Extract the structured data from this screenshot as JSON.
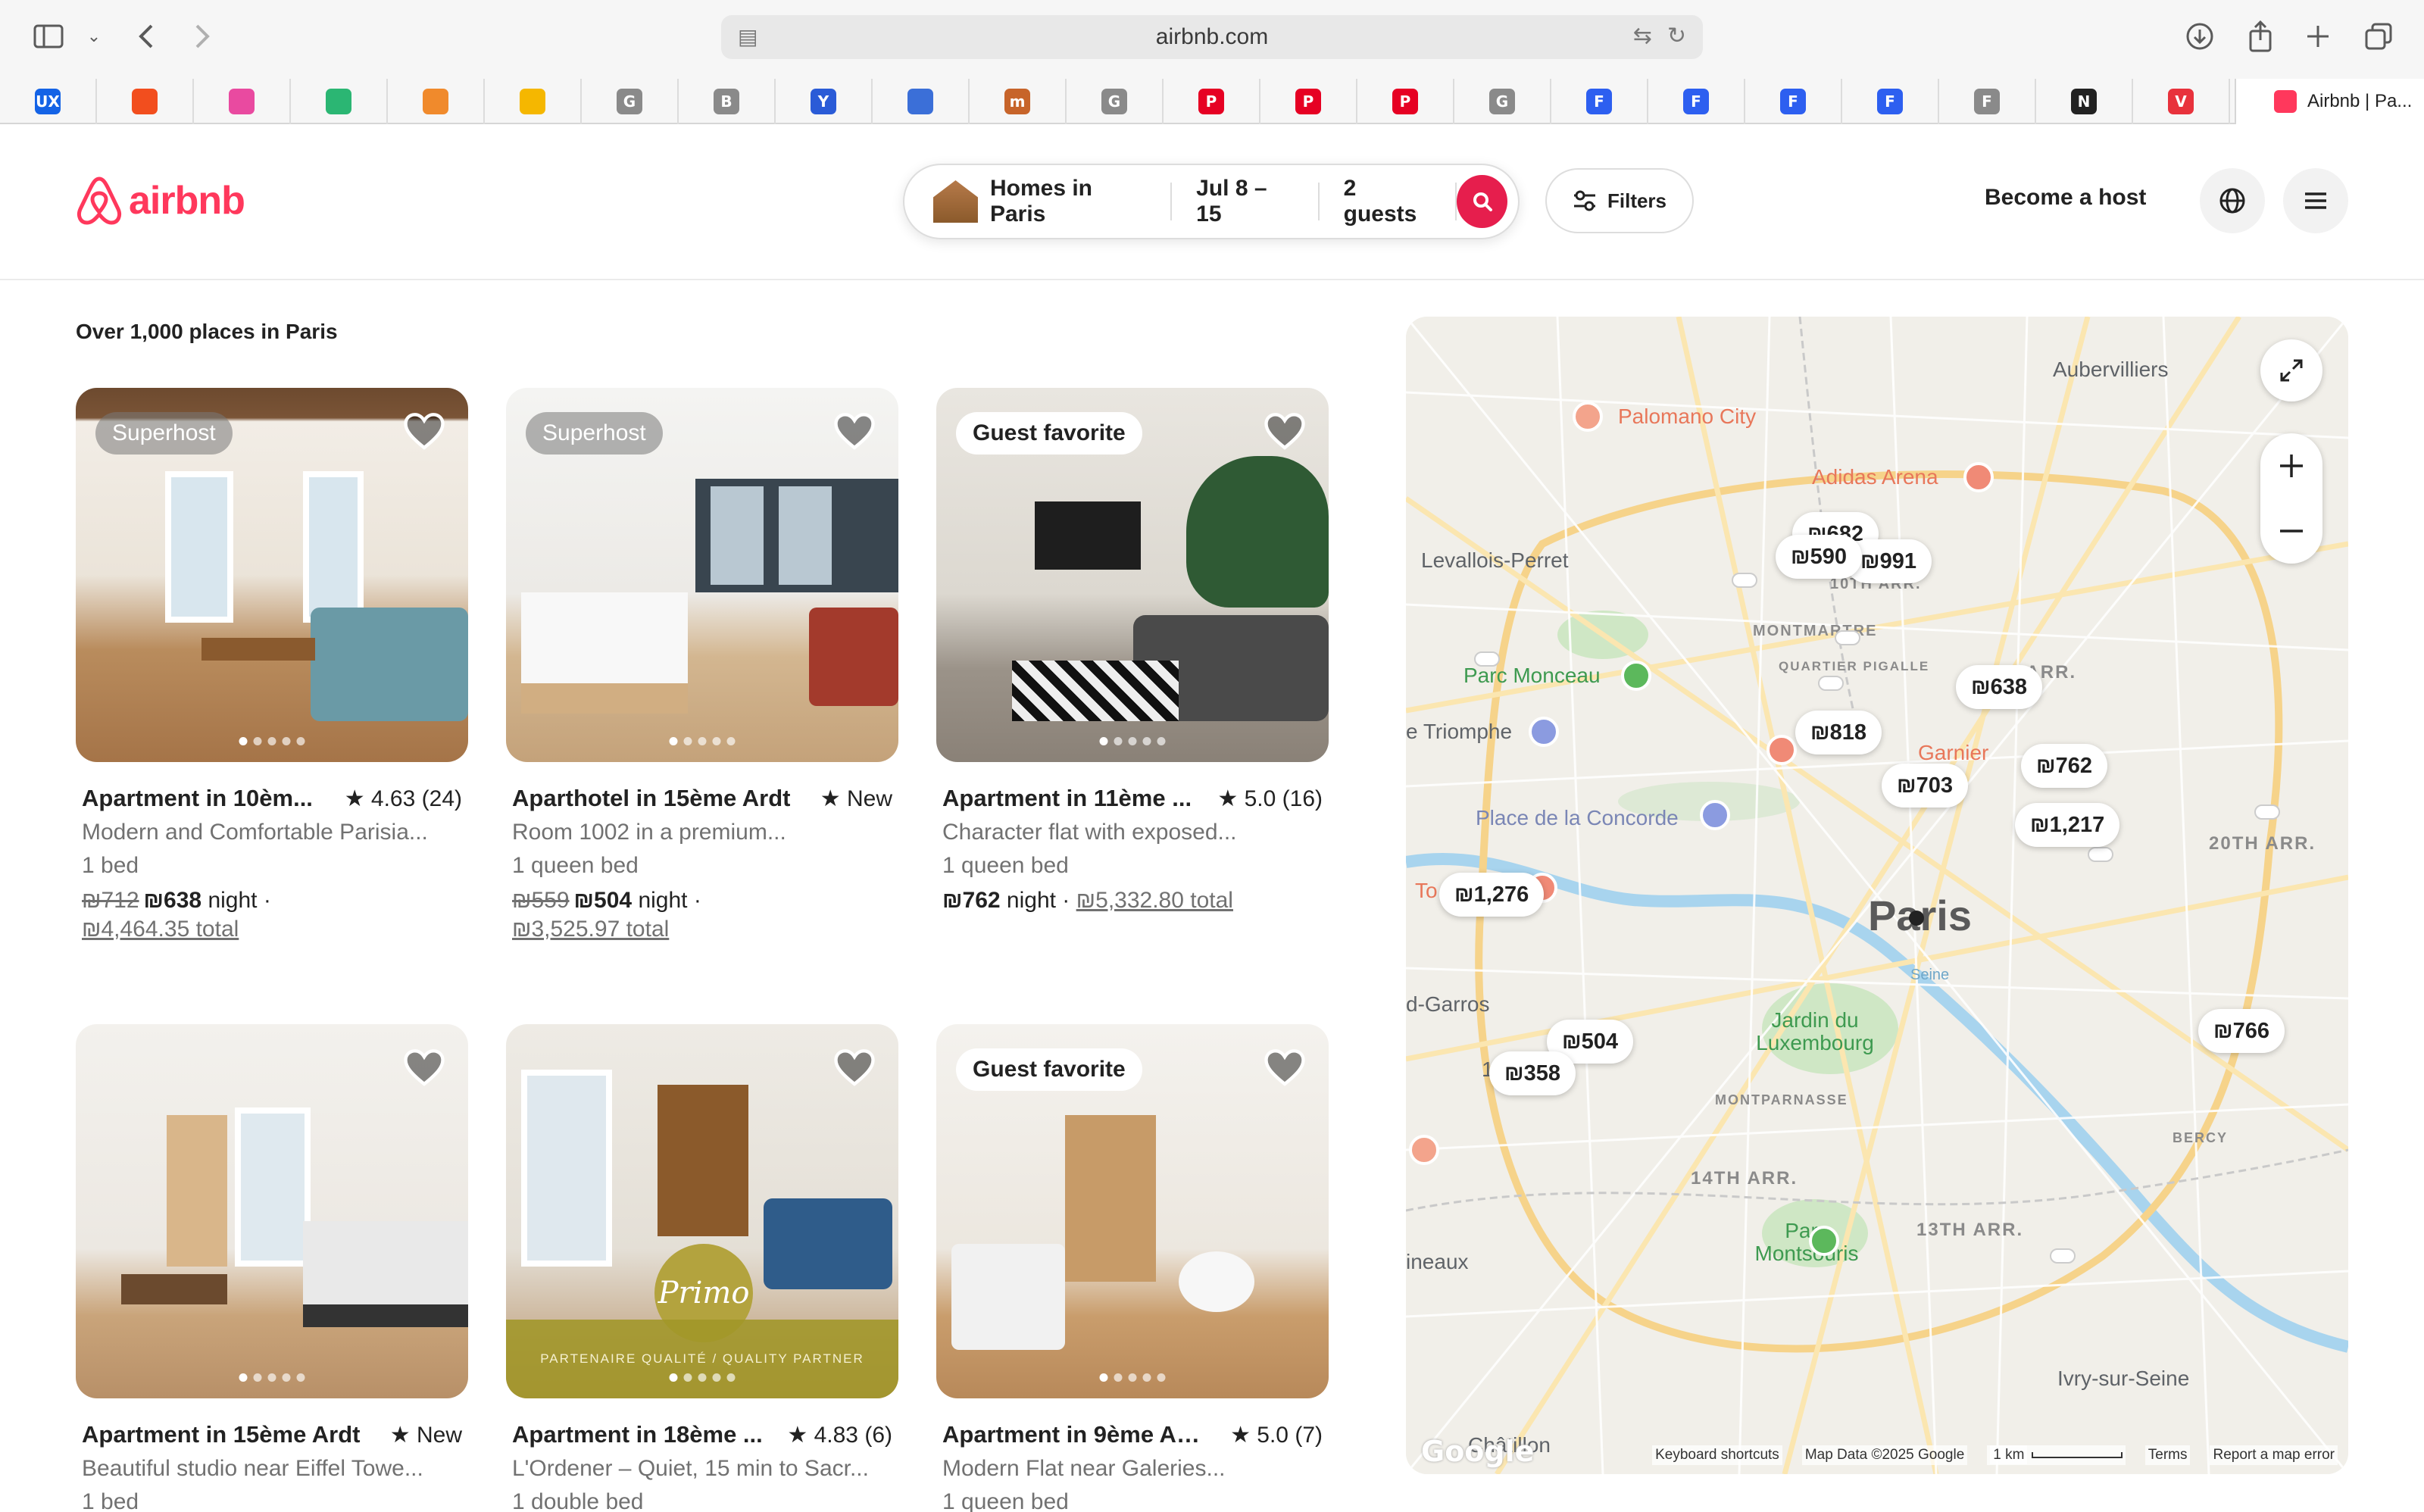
{
  "browser": {
    "address": "airbnb.com",
    "active_tab_title": "Airbnb | Pa...",
    "bookmarks": [
      {
        "icon": "ux-icon",
        "label": "UX",
        "color": "#1463e6"
      },
      {
        "icon": "figma-icon",
        "label": "",
        "color": "#f24e1e"
      },
      {
        "icon": "pink-app-icon",
        "label": "",
        "color": "#e94aa0"
      },
      {
        "icon": "green-k-icon",
        "label": "",
        "color": "#2bb673"
      },
      {
        "icon": "orange-circle-icon",
        "label": "",
        "color": "#f08a2c"
      },
      {
        "icon": "smiley-icon",
        "label": "",
        "color": "#f5b700"
      },
      {
        "icon": "grey-g-icon",
        "label": "G",
        "color": "#8a8a8a"
      },
      {
        "icon": "grey-b-icon",
        "label": "B",
        "color": "#8a8a8a"
      },
      {
        "icon": "y-icon",
        "label": "Y",
        "color": "#2a5bd7"
      },
      {
        "icon": "loader-icon",
        "label": "",
        "color": "#3b6fd8"
      },
      {
        "icon": "m-icon",
        "label": "m",
        "color": "#c7642a"
      },
      {
        "icon": "grey-g-icon",
        "label": "G",
        "color": "#8a8a8a"
      },
      {
        "icon": "pinterest-icon",
        "label": "P",
        "color": "#e60023"
      },
      {
        "icon": "pinterest-icon",
        "label": "P",
        "color": "#e60023"
      },
      {
        "icon": "pinterest-icon",
        "label": "P",
        "color": "#e60023"
      },
      {
        "icon": "grey-g-icon",
        "label": "G",
        "color": "#8a8a8a"
      },
      {
        "icon": "blue-f-icon",
        "label": "F",
        "color": "#2d5ff0"
      },
      {
        "icon": "blue-f-icon",
        "label": "F",
        "color": "#2d5ff0"
      },
      {
        "icon": "blue-f-icon",
        "label": "F",
        "color": "#2d5ff0"
      },
      {
        "icon": "blue-f-icon",
        "label": "F",
        "color": "#2d5ff0"
      },
      {
        "icon": "grey-f-icon",
        "label": "F",
        "color": "#8a8a8a"
      },
      {
        "icon": "notion-icon",
        "label": "N",
        "color": "#222222"
      },
      {
        "icon": "red-v-icon",
        "label": "V",
        "color": "#e8323c"
      }
    ]
  },
  "header": {
    "logo_text": "airbnb",
    "search": {
      "location": "Homes in Paris",
      "dates": "Jul 8 – 15",
      "guests": "2 guests"
    },
    "filters_label": "Filters",
    "become_host_label": "Become a host"
  },
  "results": {
    "count_label": "Over 1,000 places in Paris",
    "listings": [
      {
        "badge": "Superhost",
        "title": "Apartment in 10èm...",
        "rating": "★ 4.63 (24)",
        "description": "Modern and Comfortable Parisia...",
        "beds": "1 bed",
        "old_price": "₪712",
        "price": "₪638",
        "night_suffix": "night ·",
        "total": "₪4,464.35 total"
      },
      {
        "badge": "Superhost",
        "title": "Aparthotel in 15ème Ardt",
        "rating": "★ New",
        "description": "Room 1002 in a premium...",
        "beds": "1 queen bed",
        "old_price": "₪559",
        "price": "₪504",
        "night_suffix": "night ·",
        "total": "₪3,525.97 total"
      },
      {
        "badge": "Guest favorite",
        "title": "Apartment in 11ème ...",
        "rating": "★ 5.0 (16)",
        "description": "Character flat with exposed...",
        "beds": "1 queen bed",
        "old_price": "",
        "price": "₪762",
        "night_suffix": "night ·",
        "total": "₪5,332.80 total"
      },
      {
        "badge": "",
        "title": "Apartment in 15ème Ardt",
        "rating": "★ New",
        "description": "Beautiful studio near Eiffel Towe...",
        "beds": "1 bed"
      },
      {
        "badge": "",
        "title": "Apartment in 18ème ...",
        "rating": "★ 4.83 (6)",
        "description": "L'Ordener – Quiet, 15 min to Sacr...",
        "beds": "1 double bed",
        "photo_overlay": "Primo",
        "photo_banner": "PARTENAIRE QUALITÉ / QUALITY PARTNER"
      },
      {
        "badge": "Guest favorite",
        "title": "Apartment in 9ème Ar...",
        "rating": "★ 5.0 (7)",
        "description": "Modern Flat near Galeries...",
        "beds": "1 queen bed"
      }
    ]
  },
  "map": {
    "pins": [
      "₪682",
      "₪590",
      "₪991",
      "₪638",
      "₪818",
      "₪762",
      "₪703",
      "₪1,217",
      "₪1,276",
      "₪504",
      "₪358",
      "₪766"
    ],
    "labels": {
      "aubervilliers": "Aubervilliers",
      "palomano": "Palomano City",
      "adidas": "Adidas Arena",
      "levallois": "Levallois-Perret",
      "monceau": "Parc Monceau",
      "triomphe": "e Triomphe",
      "concorde": "Place de la Concorde",
      "garnier": "Garnier",
      "paris": "Paris",
      "garros": "d-Garros",
      "luxembourg": "Jardin du Luxembourg",
      "montparnasse": "MONTPARNASSE",
      "montmartre": "MONTMARTRE",
      "quartier": "QUARTIER PIGALLE",
      "arr10": "10TH ARR.",
      "arr19": "19TH ARR.",
      "arr20": "20TH ARR.",
      "arr14": "14TH ARR.",
      "arr13": "13TH ARR.",
      "bercy": "BERCY",
      "montsouris": "Parc Montsouris",
      "ineaux": "ineaux",
      "ivry": "Ivry-sur-Seine",
      "chatillon": "Châtillon",
      "seine": "Seine",
      "to": "To",
      "fifteen": "15"
    },
    "footer": {
      "shortcuts": "Keyboard shortcuts",
      "map_data": "Map Data ©2025 Google",
      "scale": "1 km",
      "terms": "Terms",
      "report": "Report a map error"
    },
    "google": "Google"
  },
  "colors": {
    "brand": "#ff385c",
    "search_button": "#e61e4d"
  }
}
